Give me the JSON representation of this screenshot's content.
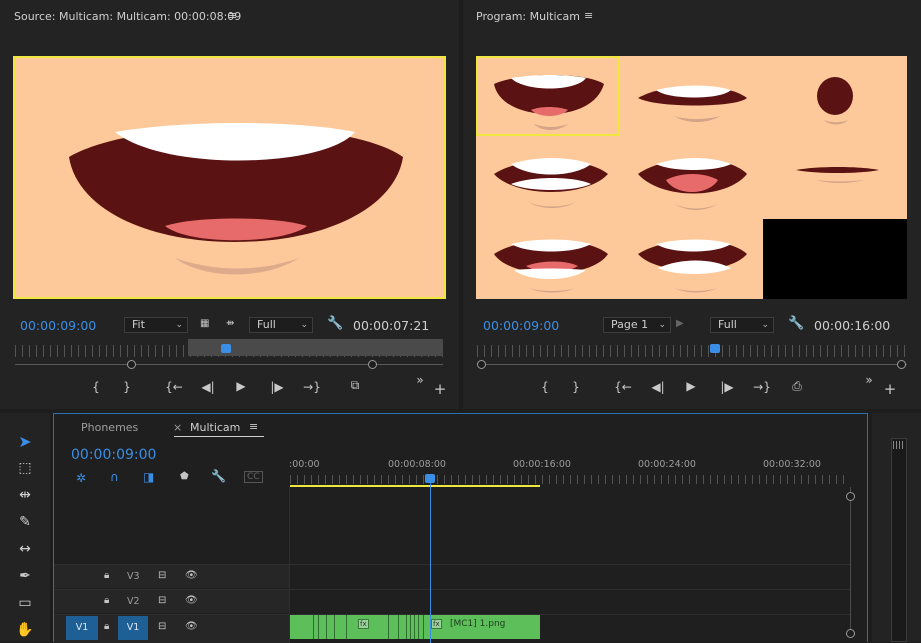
{
  "source": {
    "title": "Source: Multicam: Multicam: 00:00:08:09",
    "menu": "≡",
    "timecode_left": "00:00:09:00",
    "fit_label": "Fit",
    "quality_label": "Full",
    "timecode_right": "00:00:07:21"
  },
  "program": {
    "title": "Program: Multicam",
    "menu": "≡",
    "timecode_left": "00:00:09:00",
    "page_label": "Page 1",
    "quality_label": "Full",
    "timecode_right": "00:00:16:00"
  },
  "transport": {
    "mark_in": "{",
    "mark_out": "}",
    "go_in": "{←",
    "step_back": "◀|",
    "play": "▶",
    "step_fwd": "|▶",
    "go_out": "→}",
    "more": "»",
    "add": "+"
  },
  "timeline": {
    "tabs": [
      {
        "label": "Phonemes",
        "close": "×"
      },
      {
        "label": "Multicam",
        "menu": "≡"
      }
    ],
    "timecode": "00:00:09:00",
    "ruler_labels": [
      ":00:00",
      "00:00:08:00",
      "00:00:16:00",
      "00:00:24:00",
      "00:00:32:00"
    ],
    "tracks": [
      {
        "name": "V3"
      },
      {
        "name": "V2"
      },
      {
        "name": "V1",
        "source": "V1"
      }
    ],
    "clip_label": "[MC1] 1.png",
    "fx": "fx"
  },
  "colors": {
    "accent_blue": "#3a8ee6",
    "clip_green": "#5cbf5a",
    "highlight_yellow": "#f0e640",
    "skin": "#fdc99a",
    "mouth_dark": "#5b1212",
    "tongue": "#e86b6b"
  }
}
